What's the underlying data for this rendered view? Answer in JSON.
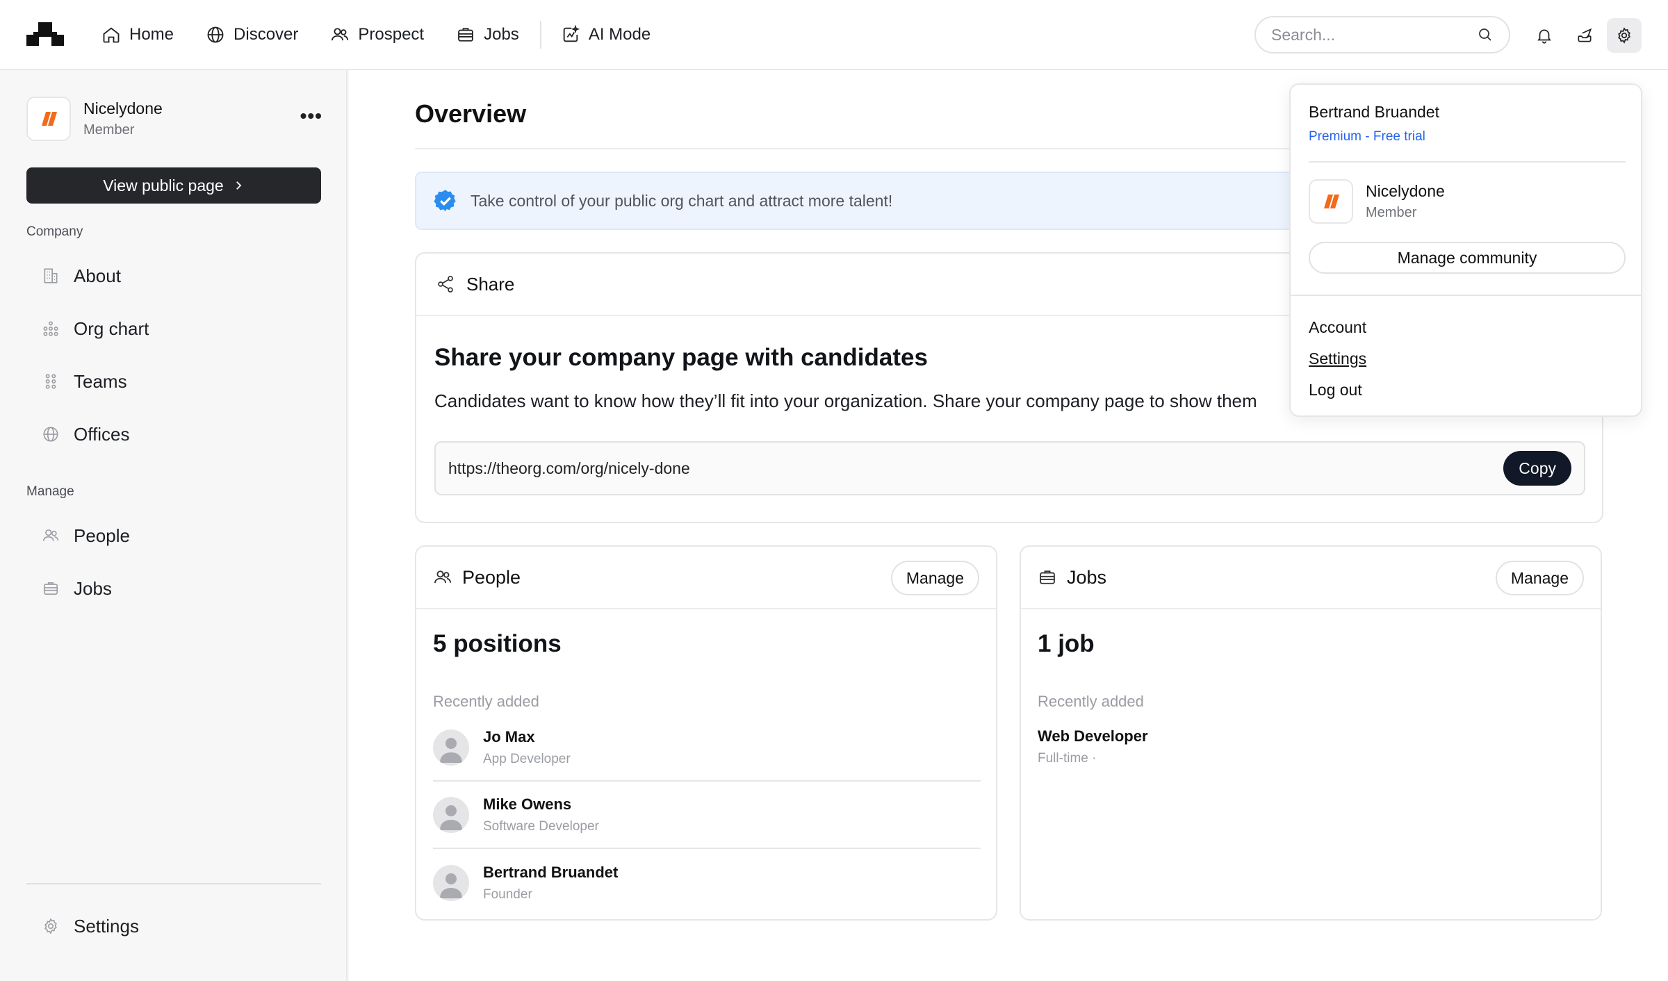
{
  "topbar": {
    "nav": [
      {
        "label": "Home",
        "icon": "home-icon"
      },
      {
        "label": "Discover",
        "icon": "globe-icon"
      },
      {
        "label": "Prospect",
        "icon": "users-icon"
      },
      {
        "label": "Jobs",
        "icon": "briefcase-icon"
      },
      {
        "label": "AI Mode",
        "icon": "ai-sparkle-icon"
      }
    ],
    "search_placeholder": "Search..."
  },
  "sidebar": {
    "org_name": "Nicelydone",
    "org_role": "Member",
    "more_label": "•••",
    "view_public_label": "View public page",
    "company_label": "Company",
    "company_items": [
      {
        "label": "About",
        "icon": "building-icon"
      },
      {
        "label": "Org chart",
        "icon": "org-chart-icon"
      },
      {
        "label": "Teams",
        "icon": "teams-icon"
      },
      {
        "label": "Offices",
        "icon": "globe-icon"
      }
    ],
    "manage_label": "Manage",
    "manage_items": [
      {
        "label": "People",
        "icon": "users-icon"
      },
      {
        "label": "Jobs",
        "icon": "briefcase-icon"
      }
    ],
    "settings_label": "Settings"
  },
  "main": {
    "title": "Overview",
    "banner_text": "Take control of your public org chart and attract more talent!",
    "share": {
      "header": "Share",
      "heading": "Share your company page with candidates",
      "text": "Candidates want to know how they’ll fit into your organization. Share your company page to show them",
      "url": "https://theorg.com/org/nicely-done",
      "copy_label": "Copy"
    },
    "people": {
      "header": "People",
      "manage_label": "Manage",
      "count": "5 positions",
      "recent_label": "Recently added",
      "items": [
        {
          "name": "Jo Max",
          "title": "App Developer"
        },
        {
          "name": "Mike Owens",
          "title": "Software Developer"
        },
        {
          "name": "Bertrand Bruandet",
          "title": "Founder"
        }
      ]
    },
    "jobs": {
      "header": "Jobs",
      "manage_label": "Manage",
      "count": "1 job",
      "recent_label": "Recently added",
      "items": [
        {
          "name": "Web Developer",
          "title": "Full-time ·"
        }
      ]
    }
  },
  "dropdown": {
    "user_name": "Bertrand Bruandet",
    "plan": "Premium - Free trial",
    "org_name": "Nicelydone",
    "org_role": "Member",
    "manage_community_label": "Manage community",
    "links": [
      "Account",
      "Settings",
      "Log out"
    ]
  },
  "colors": {
    "brand_orange": "#f26a1b",
    "dark_button": "#26272b",
    "link_blue": "#2563eb",
    "banner_bg": "#eef4fd",
    "verified_blue": "#2b8df0"
  }
}
